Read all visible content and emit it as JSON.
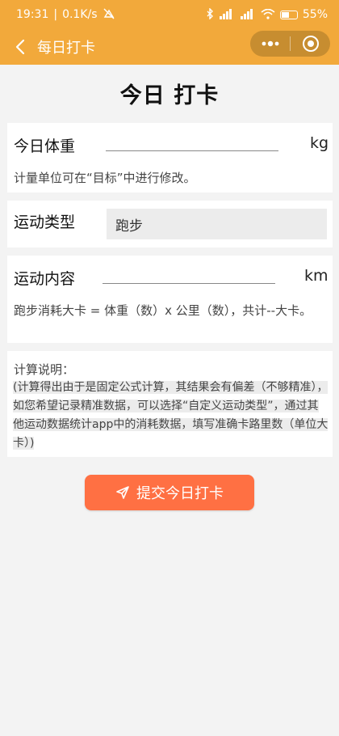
{
  "status_bar": {
    "time": "19:31",
    "speed": "0.1K/s",
    "battery": "55",
    "battery_level": 0.55
  },
  "navbar": {
    "title": "每日打卡"
  },
  "page": {
    "title": "今日 打卡"
  },
  "weight": {
    "label": "今日体重",
    "unit": "kg",
    "value": "",
    "hint": "计量单位可在“目标”中进行修改。"
  },
  "exercise_type": {
    "label": "运动类型",
    "selected": "跑步"
  },
  "exercise_content": {
    "label": "运动内容",
    "unit": "km",
    "value": "",
    "formula": "跑步消耗大卡 = 体重（数）x 公里（数），共计--大卡。"
  },
  "explanation": {
    "title": "计算说明：",
    "body": "(计算得出由于是固定公式计算，其结果会有偏差（不够精准），如您希望记录精准数据，可以选择“自定义运动类型”，通过其他运动数据统计app中的消耗数据，填写准确卡路里数（单位大卡）)"
  },
  "submit": {
    "label": "提交今日打卡"
  },
  "colors": {
    "header": "#f2a93b",
    "button": "#ff7043"
  },
  "icons": {
    "back": "chevron-left-icon",
    "more": "more-dots-icon",
    "close": "target-circle-icon",
    "submit": "send-icon"
  }
}
